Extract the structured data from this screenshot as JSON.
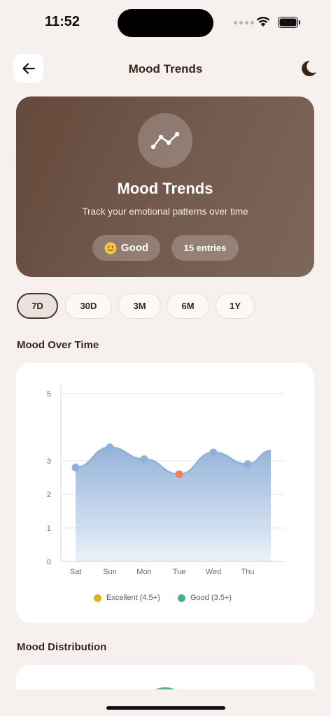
{
  "status": {
    "time": "11:52"
  },
  "header": {
    "title": "Mood Trends"
  },
  "hero": {
    "title": "Mood Trends",
    "subtitle": "Track your emotional patterns over time",
    "mood_label": "Good",
    "entries_label": "15 entries"
  },
  "ranges": [
    "7D",
    "30D",
    "3M",
    "6M",
    "1Y"
  ],
  "selected_range": "7D",
  "sections": {
    "mood_over_time": "Mood Over Time",
    "mood_distribution": "Mood Distribution"
  },
  "chart_data": {
    "type": "area",
    "categories": [
      "Sat",
      "Sun",
      "Mon",
      "Tue",
      "Wed",
      "Thu"
    ],
    "series": [
      {
        "values": [
          2.8,
          3.4,
          3.05,
          2.6,
          3.25,
          2.9
        ]
      }
    ],
    "end_value": 3.3,
    "y_ticks": [
      "0",
      "1",
      "2",
      "3",
      "5"
    ],
    "ylim": [
      0,
      5
    ],
    "grid": true,
    "point_colors": [
      "#8fb0d8",
      "#8fb0d8",
      "#8fb0d8",
      "#f07f5a",
      "#8fb0d8",
      "#8fb0d8"
    ],
    "area_color": "#8fb0d8",
    "legend": [
      {
        "label": "Excellent (4.5+)",
        "color": "#e4ad2b"
      },
      {
        "label": "Good (3.5+)",
        "color": "#4fb07f"
      }
    ]
  },
  "colors": {
    "background": "#f6f1ef",
    "hero_start": "#65493a",
    "hero_end": "#7d665a",
    "text_primary": "#3b2419"
  }
}
